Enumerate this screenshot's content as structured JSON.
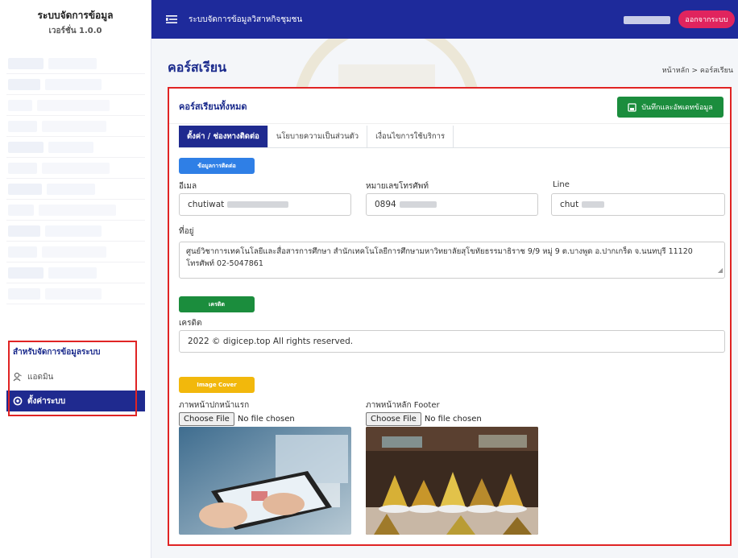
{
  "sidebar": {
    "brand_title": "ระบบจัดการข้อมูล",
    "brand_version": "เวอร์ชั่น 1.0.0",
    "section_heading": "สำหรับจัดการข้อมูลระบบ",
    "items": [
      {
        "label": "แอดมิน",
        "icon": "user-icon",
        "active": false
      },
      {
        "label": "ตั้งค่าระบบ",
        "icon": "settings-icon",
        "active": true
      }
    ]
  },
  "topbar": {
    "title": "ระบบจัดการข้อมูลวิสาหกิจชุมชน",
    "logout_label": "ออกจากระบบ"
  },
  "page": {
    "title": "คอร์สเรียน",
    "breadcrumb": "หน้าหลัก > คอร์สเรียน"
  },
  "card": {
    "title": "คอร์สเรียนทั้งหมด",
    "save_label": "บันทึกและอัพเดทข้อมูล"
  },
  "tabs": [
    {
      "label": "ตั้งค่า / ช่องทางติดต่อ",
      "active": true
    },
    {
      "label": "นโยบายความเป็นส่วนตัว",
      "active": false
    },
    {
      "label": "เงื่อนไขการใช้บริการ",
      "active": false
    }
  ],
  "contact": {
    "section_label": "ข้อมูลการติดต่อ",
    "email_label": "อีเมล",
    "email_value": "chutiwat",
    "phone_label": "หมายเลขโทรศัพท์",
    "phone_value": "0894",
    "line_label": "Line",
    "line_value": "chut",
    "address_label": "ที่อยู่",
    "address_value": "ศูนย์วิชาการเทคโนโลยีและสื่อสารการศึกษา สำนักเทคโนโลยีการศึกษามหาวิทยาลัยสุโขทัยธรรมาธิราช 9/9 หมู่ 9 ต.บางพูด อ.ปากเกร็ด จ.นนทบุรี 11120 โทรศัพท์ 02-5047861"
  },
  "credit": {
    "section_label": "เครดิต",
    "label": "เครดิต",
    "value": "2022 © digicep.top All rights reserved."
  },
  "image_cover": {
    "section_label": "Image Cover",
    "cover_label": "ภาพหน้าปกหน้าแรก",
    "footer_label": "ภาพหน้าหลัก Footer",
    "choose_label": "Choose File",
    "no_file": "No file chosen"
  },
  "colors": {
    "primary": "#1e2a9b",
    "save_green": "#1b8d3d",
    "contact_pill": "#2f7fe6",
    "credit_pill": "#1b8d3d",
    "image_pill": "#f2b80c",
    "logout": "#e0245e",
    "highlight": "#e02424"
  }
}
